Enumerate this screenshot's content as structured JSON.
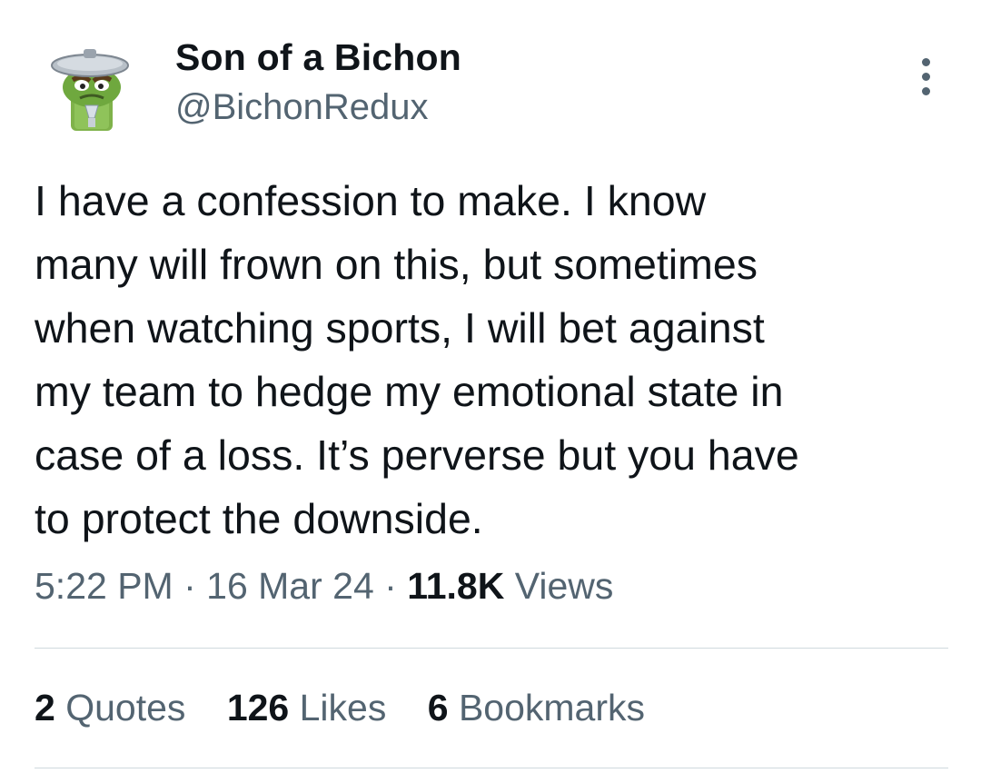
{
  "author": {
    "display_name": "Son of a Bichon",
    "handle": "@BichonRedux",
    "avatar_icon": "grouch-in-trash-can-avatar-icon"
  },
  "more_icon": "more-vertical-icon",
  "tweet": {
    "text": "I have a confession to make. I know\nmany will frown on this, but sometimes\nwhen watching sports, I will bet against\nmy team to hedge my emotional state in\ncase of a loss. It’s perverse but you have\nto protect the downside."
  },
  "meta": {
    "time": "5:22 PM",
    "sep1": " · ",
    "date": "16 Mar 24",
    "sep2": " · ",
    "views_count": "11.8K",
    "views_label": " Views"
  },
  "stats": {
    "quotes_count": "2",
    "quotes_label": " Quotes",
    "likes_count": "126",
    "likes_label": " Likes",
    "bookmarks_count": "6",
    "bookmarks_label": " Bookmarks"
  },
  "colors": {
    "text_primary": "#0f1419",
    "text_secondary": "#536471",
    "divider": "#cfd9de"
  }
}
